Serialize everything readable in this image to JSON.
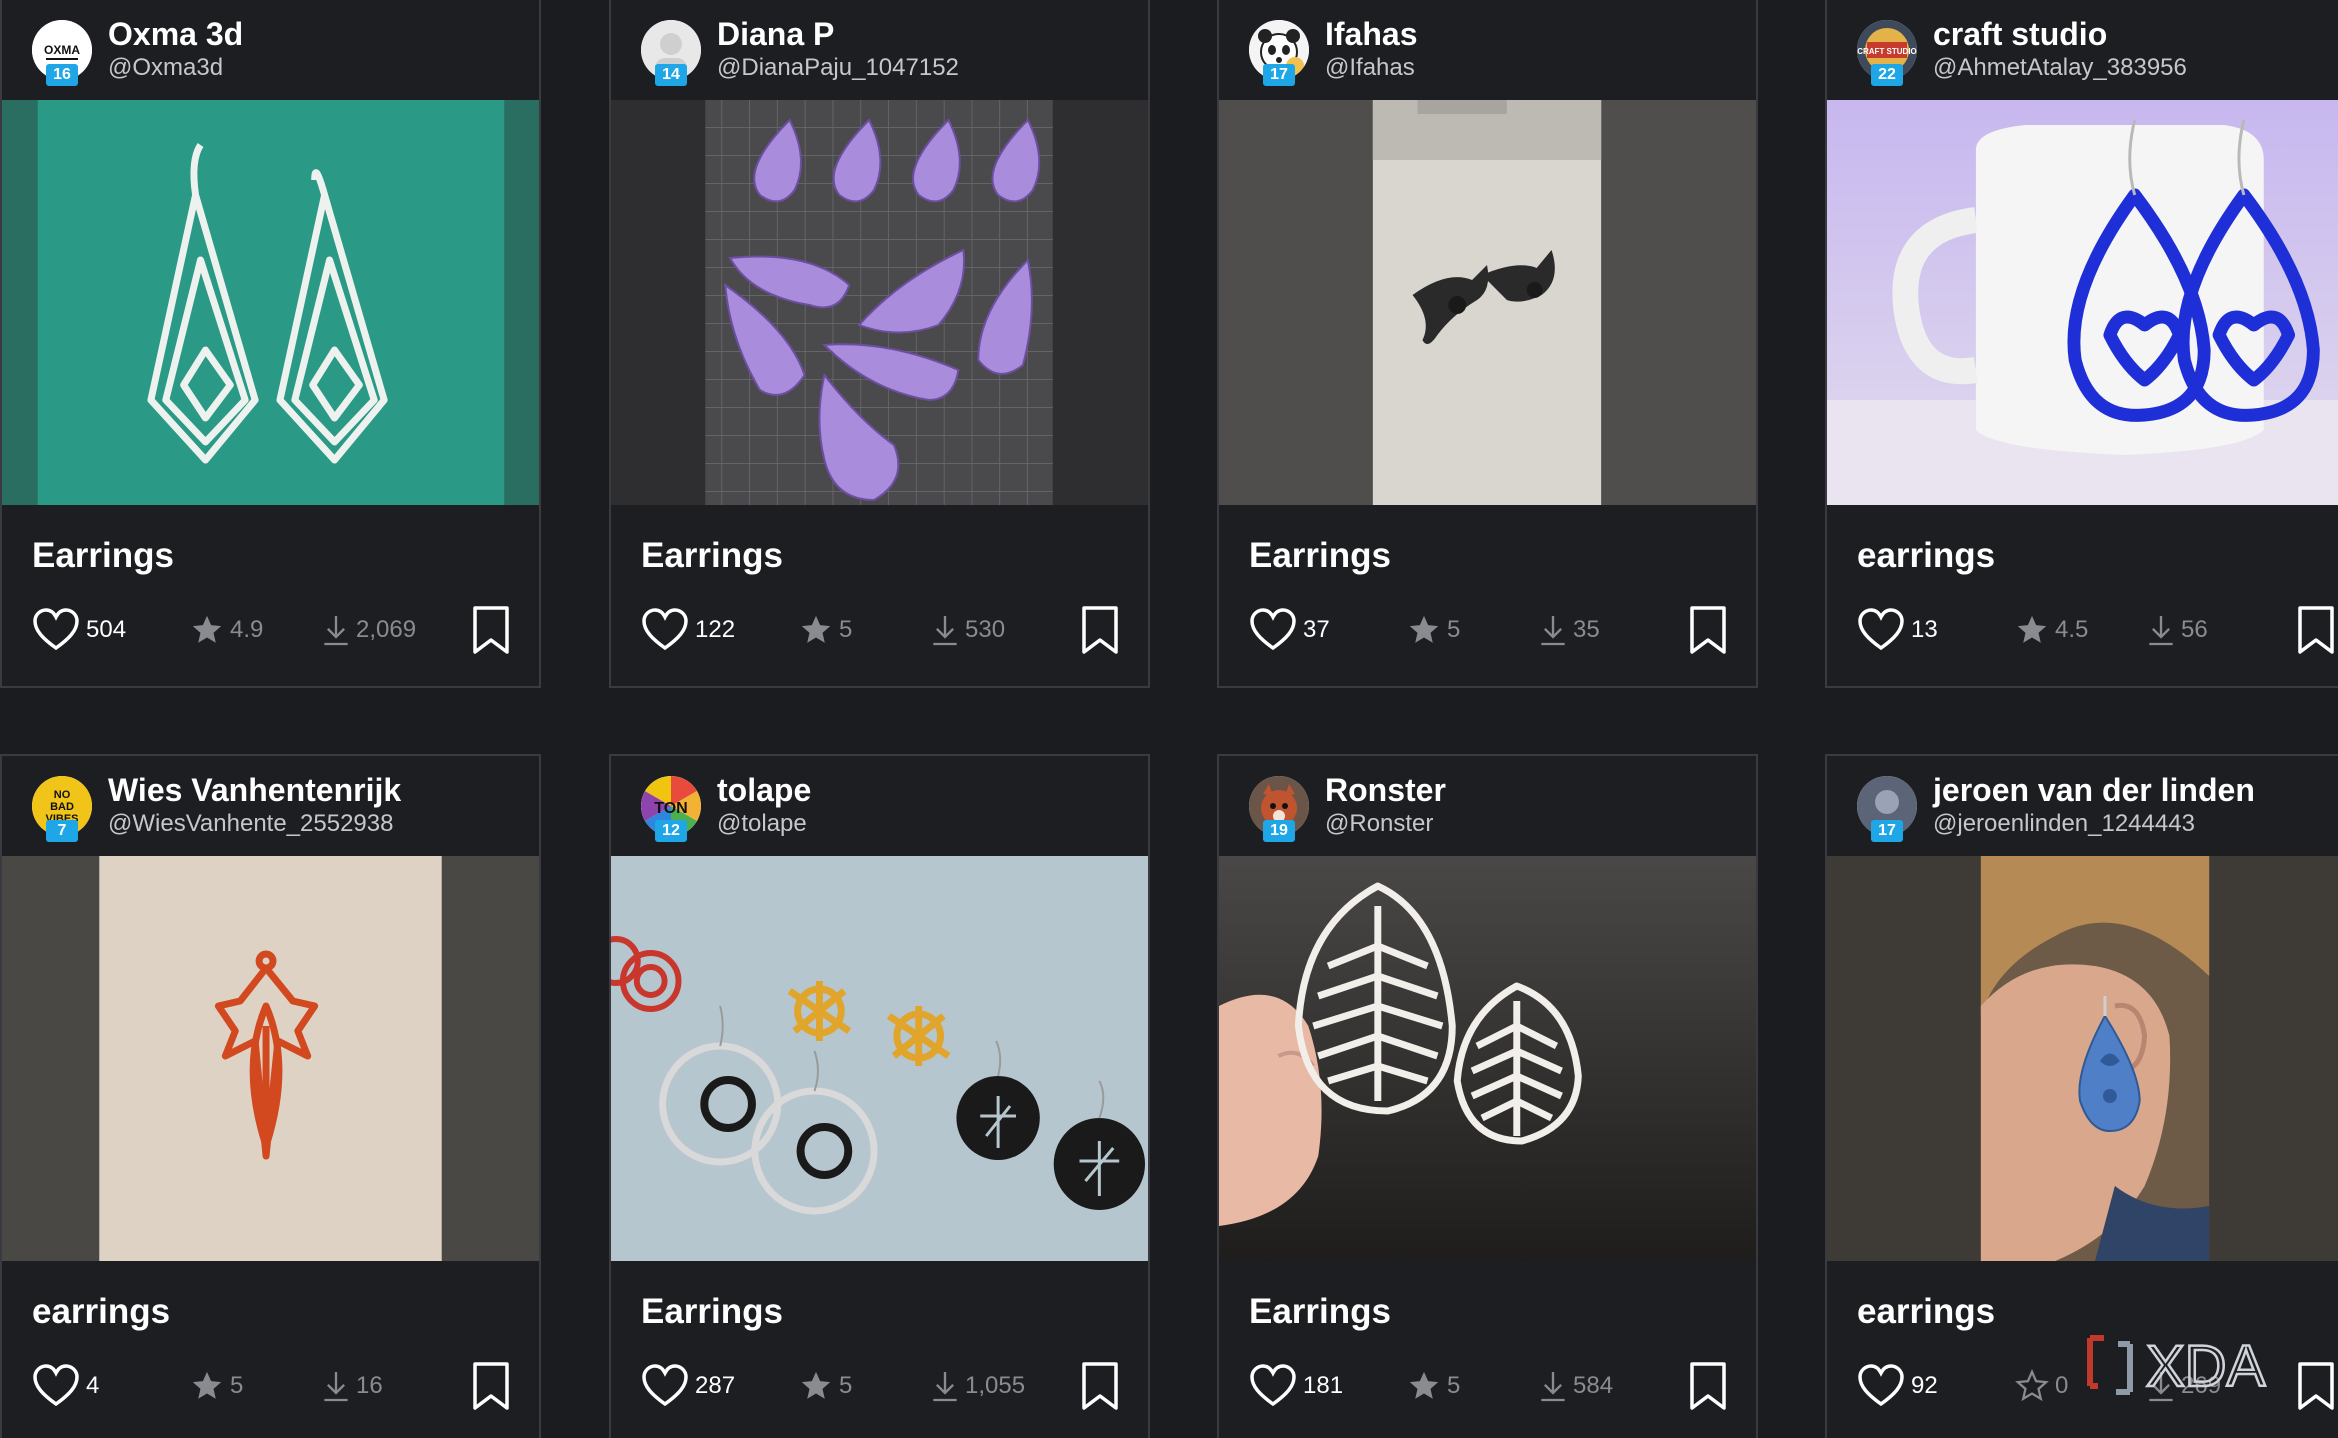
{
  "cards": [
    {
      "name": "Oxma 3d",
      "handle": "@Oxma3d",
      "level": "16",
      "title": "Earrings",
      "likes": "504",
      "rating": "4.9",
      "downloads": "2,069",
      "avatar_text": "OXMA"
    },
    {
      "name": "Diana P",
      "handle": "@DianaPaju_1047152",
      "level": "14",
      "title": "Earrings",
      "likes": "122",
      "rating": "5",
      "downloads": "530",
      "avatar_text": ""
    },
    {
      "name": "Ifahas",
      "handle": "@Ifahas",
      "level": "17",
      "title": "Earrings",
      "likes": "37",
      "rating": "5",
      "downloads": "35",
      "avatar_text": ""
    },
    {
      "name": "craft studio",
      "handle": "@AhmetAtalay_383956",
      "level": "22",
      "title": "earrings",
      "likes": "13",
      "rating": "4.5",
      "downloads": "56",
      "avatar_text": "CRAFT STUDIO"
    },
    {
      "name": "Wies Vanhentenrijk",
      "handle": "@WiesVanhente_2552938",
      "level": "7",
      "title": "earrings",
      "likes": "4",
      "rating": "5",
      "downloads": "16",
      "avatar_text": "NO BAD VIBES"
    },
    {
      "name": "tolape",
      "handle": "@tolape",
      "level": "12",
      "title": "Earrings",
      "likes": "287",
      "rating": "5",
      "downloads": "1,055",
      "avatar_text": "TON"
    },
    {
      "name": "Ronster",
      "handle": "@Ronster",
      "level": "19",
      "title": "Earrings",
      "likes": "181",
      "rating": "5",
      "downloads": "584",
      "avatar_text": ""
    },
    {
      "name": "jeroen van der linden",
      "handle": "@jeroenlinden_1244443",
      "level": "17",
      "title": "earrings",
      "likes": "92",
      "rating": "0",
      "downloads": "269",
      "avatar_text": ""
    }
  ],
  "watermark": "XDA",
  "icons": {
    "like": "heart-icon",
    "rating": "star-icon",
    "download": "download-icon",
    "bookmark": "bookmark-icon"
  },
  "colors": {
    "background": "#1b1c20",
    "card": "#1d1e22",
    "level_badge": "#1ea6e6",
    "text": "#ffffff",
    "muted": "#8a8b90"
  }
}
